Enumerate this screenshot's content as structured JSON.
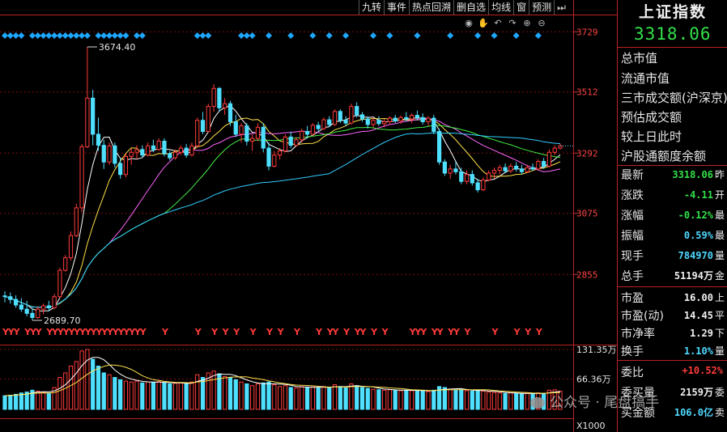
{
  "toolbar": {
    "buttons": [
      "九转",
      "事件",
      "热点回溯",
      "删自选",
      "均线",
      "窗",
      "预测"
    ],
    "arrow_icon": "⏭"
  },
  "icons": [
    "eye-icon",
    "hand-icon",
    "undo-icon",
    "redo-icon",
    "zoom-in-icon",
    "zoom-out-icon"
  ],
  "panel": {
    "name": "上证指数",
    "price": "3318.06",
    "top_labels": [
      "总市值",
      "流通市值",
      "三市成交额(沪深京)",
      "预估成交额",
      "较上日此时",
      "沪股通额度余额"
    ],
    "rows1": [
      {
        "k": "最新",
        "v": "3318.06",
        "unit": "昨",
        "cls": "g"
      },
      {
        "k": "涨跌",
        "v": "-4.11",
        "unit": "开",
        "cls": "g"
      },
      {
        "k": "涨幅",
        "v": "-0.12%",
        "unit": "最",
        "cls": "g"
      },
      {
        "k": "振幅",
        "v": "0.59%",
        "unit": "最",
        "cls": "c"
      },
      {
        "k": "现手",
        "v": "784970",
        "unit": "量",
        "cls": "c"
      },
      {
        "k": "总手",
        "v": "51194万",
        "unit": "金",
        "cls": "w"
      }
    ],
    "rows2": [
      {
        "k": "市盈",
        "v": "16.00",
        "unit": "上",
        "cls": "w"
      },
      {
        "k": "市盈(动)",
        "v": "14.45",
        "unit": "平",
        "cls": "w"
      },
      {
        "k": "市净率",
        "v": "1.29",
        "unit": "下",
        "cls": "w"
      },
      {
        "k": "换手",
        "v": "1.10%",
        "unit": "量",
        "cls": "c"
      }
    ],
    "rows3": [
      {
        "k": "委比",
        "v": "+10.52%",
        "unit": "",
        "cls": "r"
      },
      {
        "k": "委买量",
        "v": "2159万",
        "unit": "委",
        "cls": "w"
      },
      {
        "k": "买金额",
        "v": "106.0亿",
        "unit": "卖",
        "cls": "c"
      }
    ]
  },
  "watermark": "公众号 · 尾盘搞手",
  "colors": {
    "up": "#ff3b3b",
    "down": "#4fe0ff",
    "ma5": "#ffffff",
    "ma10": "#ffe14a",
    "ma20": "#ff66ff",
    "ma30": "#44ee44",
    "ma60": "#33ccff",
    "vol_ma5": "#ffffff",
    "vol_ma10": "#ffe14a"
  },
  "chart_data": {
    "type": "candlestick",
    "ylim": [
      2689.7,
      3674.4
    ],
    "y_ticks": [
      3729,
      3512,
      3292,
      3075,
      2855
    ],
    "annotations": [
      {
        "label": "3674.40",
        "type": "high"
      },
      {
        "label": "2689.70",
        "type": "low"
      }
    ],
    "volume": {
      "ticks": [
        "131.35万",
        "66.36万"
      ],
      "unit": "X1000",
      "max": 1313500
    },
    "signal_label": "Y",
    "candles": [
      {
        "o": 2778,
        "h": 2795,
        "l": 2755,
        "c": 2775,
        "v": 300000
      },
      {
        "o": 2775,
        "h": 2790,
        "l": 2750,
        "c": 2765,
        "v": 310000
      },
      {
        "o": 2765,
        "h": 2780,
        "l": 2735,
        "c": 2745,
        "v": 330000
      },
      {
        "o": 2745,
        "h": 2770,
        "l": 2720,
        "c": 2730,
        "v": 360000
      },
      {
        "o": 2730,
        "h": 2760,
        "l": 2705,
        "c": 2715,
        "v": 380000
      },
      {
        "o": 2715,
        "h": 2735,
        "l": 2689.7,
        "c": 2700,
        "v": 420000
      },
      {
        "o": 2700,
        "h": 2740,
        "l": 2695,
        "c": 2730,
        "v": 400000
      },
      {
        "o": 2730,
        "h": 2750,
        "l": 2712,
        "c": 2742,
        "v": 370000
      },
      {
        "o": 2742,
        "h": 2760,
        "l": 2722,
        "c": 2735,
        "v": 350000
      },
      {
        "o": 2735,
        "h": 2785,
        "l": 2730,
        "c": 2775,
        "v": 480000
      },
      {
        "o": 2775,
        "h": 2880,
        "l": 2770,
        "c": 2870,
        "v": 700000
      },
      {
        "o": 2870,
        "h": 2925,
        "l": 2865,
        "c": 2915,
        "v": 800000
      },
      {
        "o": 2915,
        "h": 3010,
        "l": 2905,
        "c": 2995,
        "v": 950000
      },
      {
        "o": 2995,
        "h": 3110,
        "l": 2990,
        "c": 3095,
        "v": 1050000
      },
      {
        "o": 3095,
        "h": 3325,
        "l": 3080,
        "c": 3315,
        "v": 1280000
      },
      {
        "o": 3315,
        "h": 3674.4,
        "l": 3310,
        "c": 3490,
        "v": 1313500
      },
      {
        "o": 3490,
        "h": 3520,
        "l": 3320,
        "c": 3360,
        "v": 1100000
      },
      {
        "o": 3360,
        "h": 3420,
        "l": 3300,
        "c": 3320,
        "v": 950000
      },
      {
        "o": 3320,
        "h": 3340,
        "l": 3235,
        "c": 3260,
        "v": 800000
      },
      {
        "o": 3260,
        "h": 3330,
        "l": 3250,
        "c": 3318,
        "v": 760000
      },
      {
        "o": 3318,
        "h": 3330,
        "l": 3240,
        "c": 3255,
        "v": 700000
      },
      {
        "o": 3255,
        "h": 3275,
        "l": 3200,
        "c": 3215,
        "v": 650000
      },
      {
        "o": 3215,
        "h": 3290,
        "l": 3205,
        "c": 3280,
        "v": 620000
      },
      {
        "o": 3280,
        "h": 3310,
        "l": 3250,
        "c": 3295,
        "v": 600000
      },
      {
        "o": 3295,
        "h": 3320,
        "l": 3270,
        "c": 3305,
        "v": 620000
      },
      {
        "o": 3305,
        "h": 3320,
        "l": 3275,
        "c": 3285,
        "v": 580000
      },
      {
        "o": 3285,
        "h": 3330,
        "l": 3280,
        "c": 3318,
        "v": 600000
      },
      {
        "o": 3318,
        "h": 3340,
        "l": 3295,
        "c": 3305,
        "v": 590000
      },
      {
        "o": 3305,
        "h": 3345,
        "l": 3300,
        "c": 3335,
        "v": 610000
      },
      {
        "o": 3335,
        "h": 3345,
        "l": 3280,
        "c": 3290,
        "v": 580000
      },
      {
        "o": 3290,
        "h": 3300,
        "l": 3265,
        "c": 3275,
        "v": 560000
      },
      {
        "o": 3275,
        "h": 3305,
        "l": 3268,
        "c": 3295,
        "v": 570000
      },
      {
        "o": 3295,
        "h": 3320,
        "l": 3285,
        "c": 3310,
        "v": 580000
      },
      {
        "o": 3310,
        "h": 3325,
        "l": 3275,
        "c": 3285,
        "v": 560000
      },
      {
        "o": 3285,
        "h": 3330,
        "l": 3280,
        "c": 3318,
        "v": 600000
      },
      {
        "o": 3318,
        "h": 3420,
        "l": 3312,
        "c": 3410,
        "v": 760000
      },
      {
        "o": 3410,
        "h": 3440,
        "l": 3360,
        "c": 3370,
        "v": 700000
      },
      {
        "o": 3370,
        "h": 3470,
        "l": 3365,
        "c": 3460,
        "v": 800000
      },
      {
        "o": 3460,
        "h": 3540,
        "l": 3440,
        "c": 3525,
        "v": 840000
      },
      {
        "o": 3525,
        "h": 3530,
        "l": 3440,
        "c": 3455,
        "v": 780000
      },
      {
        "o": 3455,
        "h": 3490,
        "l": 3430,
        "c": 3470,
        "v": 720000
      },
      {
        "o": 3470,
        "h": 3480,
        "l": 3390,
        "c": 3405,
        "v": 700000
      },
      {
        "o": 3405,
        "h": 3430,
        "l": 3350,
        "c": 3360,
        "v": 650000
      },
      {
        "o": 3360,
        "h": 3400,
        "l": 3330,
        "c": 3390,
        "v": 600000
      },
      {
        "o": 3390,
        "h": 3400,
        "l": 3320,
        "c": 3335,
        "v": 560000
      },
      {
        "o": 3335,
        "h": 3360,
        "l": 3300,
        "c": 3345,
        "v": 520000
      },
      {
        "o": 3345,
        "h": 3400,
        "l": 3335,
        "c": 3385,
        "v": 560000
      },
      {
        "o": 3385,
        "h": 3400,
        "l": 3295,
        "c": 3310,
        "v": 580000
      },
      {
        "o": 3310,
        "h": 3330,
        "l": 3230,
        "c": 3245,
        "v": 600000
      },
      {
        "o": 3245,
        "h": 3300,
        "l": 3240,
        "c": 3285,
        "v": 540000
      },
      {
        "o": 3285,
        "h": 3310,
        "l": 3270,
        "c": 3300,
        "v": 500000
      },
      {
        "o": 3300,
        "h": 3360,
        "l": 3295,
        "c": 3350,
        "v": 520000
      },
      {
        "o": 3350,
        "h": 3370,
        "l": 3310,
        "c": 3320,
        "v": 480000
      },
      {
        "o": 3320,
        "h": 3350,
        "l": 3315,
        "c": 3340,
        "v": 470000
      },
      {
        "o": 3340,
        "h": 3380,
        "l": 3330,
        "c": 3370,
        "v": 500000
      },
      {
        "o": 3370,
        "h": 3390,
        "l": 3345,
        "c": 3360,
        "v": 480000
      },
      {
        "o": 3360,
        "h": 3400,
        "l": 3355,
        "c": 3392,
        "v": 490000
      },
      {
        "o": 3392,
        "h": 3405,
        "l": 3370,
        "c": 3380,
        "v": 470000
      },
      {
        "o": 3380,
        "h": 3420,
        "l": 3375,
        "c": 3412,
        "v": 500000
      },
      {
        "o": 3412,
        "h": 3425,
        "l": 3385,
        "c": 3395,
        "v": 480000
      },
      {
        "o": 3395,
        "h": 3450,
        "l": 3390,
        "c": 3442,
        "v": 540000
      },
      {
        "o": 3442,
        "h": 3450,
        "l": 3400,
        "c": 3410,
        "v": 500000
      },
      {
        "o": 3410,
        "h": 3425,
        "l": 3390,
        "c": 3400,
        "v": 470000
      },
      {
        "o": 3400,
        "h": 3470,
        "l": 3395,
        "c": 3460,
        "v": 560000
      },
      {
        "o": 3460,
        "h": 3475,
        "l": 3420,
        "c": 3430,
        "v": 520000
      },
      {
        "o": 3430,
        "h": 3440,
        "l": 3405,
        "c": 3415,
        "v": 480000
      },
      {
        "o": 3415,
        "h": 3425,
        "l": 3380,
        "c": 3395,
        "v": 460000
      },
      {
        "o": 3395,
        "h": 3420,
        "l": 3385,
        "c": 3410,
        "v": 440000
      },
      {
        "o": 3410,
        "h": 3425,
        "l": 3390,
        "c": 3398,
        "v": 430000
      },
      {
        "o": 3398,
        "h": 3415,
        "l": 3385,
        "c": 3405,
        "v": 420000
      },
      {
        "o": 3405,
        "h": 3425,
        "l": 3395,
        "c": 3418,
        "v": 430000
      },
      {
        "o": 3418,
        "h": 3430,
        "l": 3400,
        "c": 3408,
        "v": 420000
      },
      {
        "o": 3408,
        "h": 3428,
        "l": 3398,
        "c": 3420,
        "v": 410000
      },
      {
        "o": 3420,
        "h": 3440,
        "l": 3405,
        "c": 3415,
        "v": 420000
      },
      {
        "o": 3415,
        "h": 3435,
        "l": 3400,
        "c": 3428,
        "v": 410000
      },
      {
        "o": 3428,
        "h": 3445,
        "l": 3410,
        "c": 3420,
        "v": 420000
      },
      {
        "o": 3420,
        "h": 3435,
        "l": 3395,
        "c": 3405,
        "v": 400000
      },
      {
        "o": 3405,
        "h": 3425,
        "l": 3390,
        "c": 3418,
        "v": 390000
      },
      {
        "o": 3418,
        "h": 3430,
        "l": 3360,
        "c": 3370,
        "v": 420000
      },
      {
        "o": 3370,
        "h": 3380,
        "l": 3250,
        "c": 3260,
        "v": 500000
      },
      {
        "o": 3260,
        "h": 3270,
        "l": 3210,
        "c": 3220,
        "v": 480000
      },
      {
        "o": 3220,
        "h": 3250,
        "l": 3200,
        "c": 3235,
        "v": 440000
      },
      {
        "o": 3235,
        "h": 3260,
        "l": 3215,
        "c": 3225,
        "v": 420000
      },
      {
        "o": 3225,
        "h": 3240,
        "l": 3180,
        "c": 3190,
        "v": 430000
      },
      {
        "o": 3190,
        "h": 3230,
        "l": 3180,
        "c": 3215,
        "v": 410000
      },
      {
        "o": 3215,
        "h": 3230,
        "l": 3175,
        "c": 3185,
        "v": 400000
      },
      {
        "o": 3185,
        "h": 3200,
        "l": 3150,
        "c": 3160,
        "v": 420000
      },
      {
        "o": 3160,
        "h": 3205,
        "l": 3155,
        "c": 3195,
        "v": 400000
      },
      {
        "o": 3195,
        "h": 3230,
        "l": 3190,
        "c": 3220,
        "v": 380000
      },
      {
        "o": 3220,
        "h": 3240,
        "l": 3200,
        "c": 3230,
        "v": 370000
      },
      {
        "o": 3230,
        "h": 3250,
        "l": 3215,
        "c": 3240,
        "v": 360000
      },
      {
        "o": 3240,
        "h": 3255,
        "l": 3220,
        "c": 3228,
        "v": 350000
      },
      {
        "o": 3228,
        "h": 3255,
        "l": 3220,
        "c": 3245,
        "v": 360000
      },
      {
        "o": 3245,
        "h": 3260,
        "l": 3225,
        "c": 3235,
        "v": 350000
      },
      {
        "o": 3235,
        "h": 3250,
        "l": 3215,
        "c": 3225,
        "v": 340000
      },
      {
        "o": 3225,
        "h": 3250,
        "l": 3220,
        "c": 3240,
        "v": 350000
      },
      {
        "o": 3240,
        "h": 3255,
        "l": 3228,
        "c": 3235,
        "v": 340000
      },
      {
        "o": 3235,
        "h": 3270,
        "l": 3230,
        "c": 3262,
        "v": 360000
      },
      {
        "o": 3262,
        "h": 3275,
        "l": 3235,
        "c": 3245,
        "v": 350000
      },
      {
        "o": 3245,
        "h": 3305,
        "l": 3240,
        "c": 3295,
        "v": 420000
      },
      {
        "o": 3295,
        "h": 3320,
        "l": 3285,
        "c": 3310,
        "v": 430000
      },
      {
        "o": 3310,
        "h": 3325,
        "l": 3305,
        "c": 3318.06,
        "v": 400000
      }
    ]
  }
}
